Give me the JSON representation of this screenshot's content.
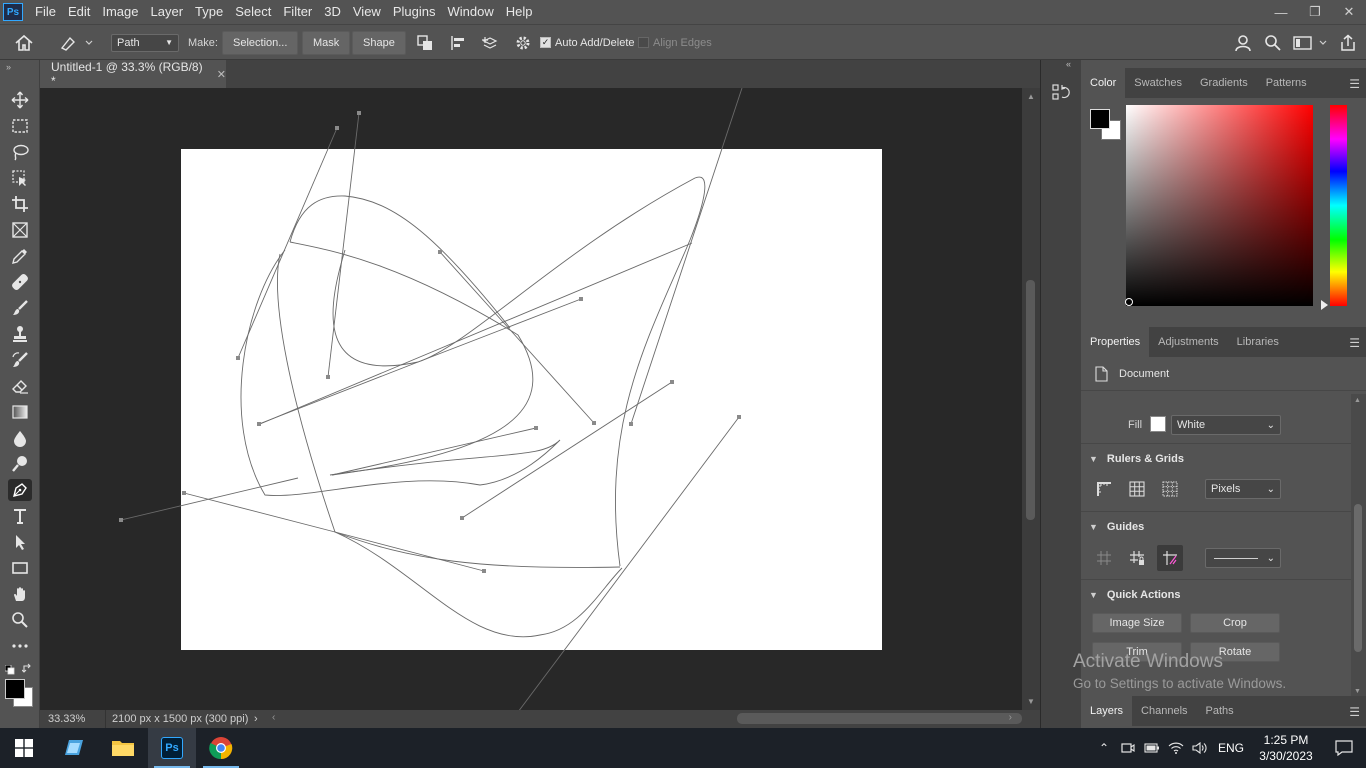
{
  "app": {
    "logo": "Ps"
  },
  "menu": [
    "File",
    "Edit",
    "Image",
    "Layer",
    "Type",
    "Select",
    "Filter",
    "3D",
    "View",
    "Plugins",
    "Window",
    "Help"
  ],
  "options": {
    "mode_value": "Path",
    "make_label": "Make:",
    "selection_label": "Selection...",
    "mask_label": "Mask",
    "shape_label": "Shape",
    "auto_add_label": "Auto Add/Delete",
    "align_edges_label": "Align Edges"
  },
  "document": {
    "tab_title": "Untitled-1 @ 33.3% (RGB/8) *",
    "zoom": "33.33%",
    "info": "2100 px x 1500 px (300 ppi)"
  },
  "color_panel": {
    "tabs": [
      "Color",
      "Swatches",
      "Gradients",
      "Patterns"
    ],
    "foreground": "#000000",
    "background": "#ffffff",
    "hue": "#ff0000"
  },
  "properties_panel": {
    "tabs": [
      "Properties",
      "Adjustments",
      "Libraries"
    ],
    "doc_label": "Document",
    "fill_label": "Fill",
    "fill_value": "White",
    "rulers_title": "Rulers & Grids",
    "units_value": "Pixels",
    "guides_title": "Guides",
    "quick_actions_title": "Quick Actions",
    "buttons": [
      "Image Size",
      "Crop",
      "Trim",
      "Rotate"
    ]
  },
  "layers_panel": {
    "tabs": [
      "Layers",
      "Channels",
      "Paths"
    ]
  },
  "watermark": {
    "title": "Activate Windows",
    "subtitle": "Go to Settings to activate Windows."
  },
  "taskbar": {
    "language": "ENG",
    "time": "1:25 PM",
    "date": "3/30/2023"
  }
}
